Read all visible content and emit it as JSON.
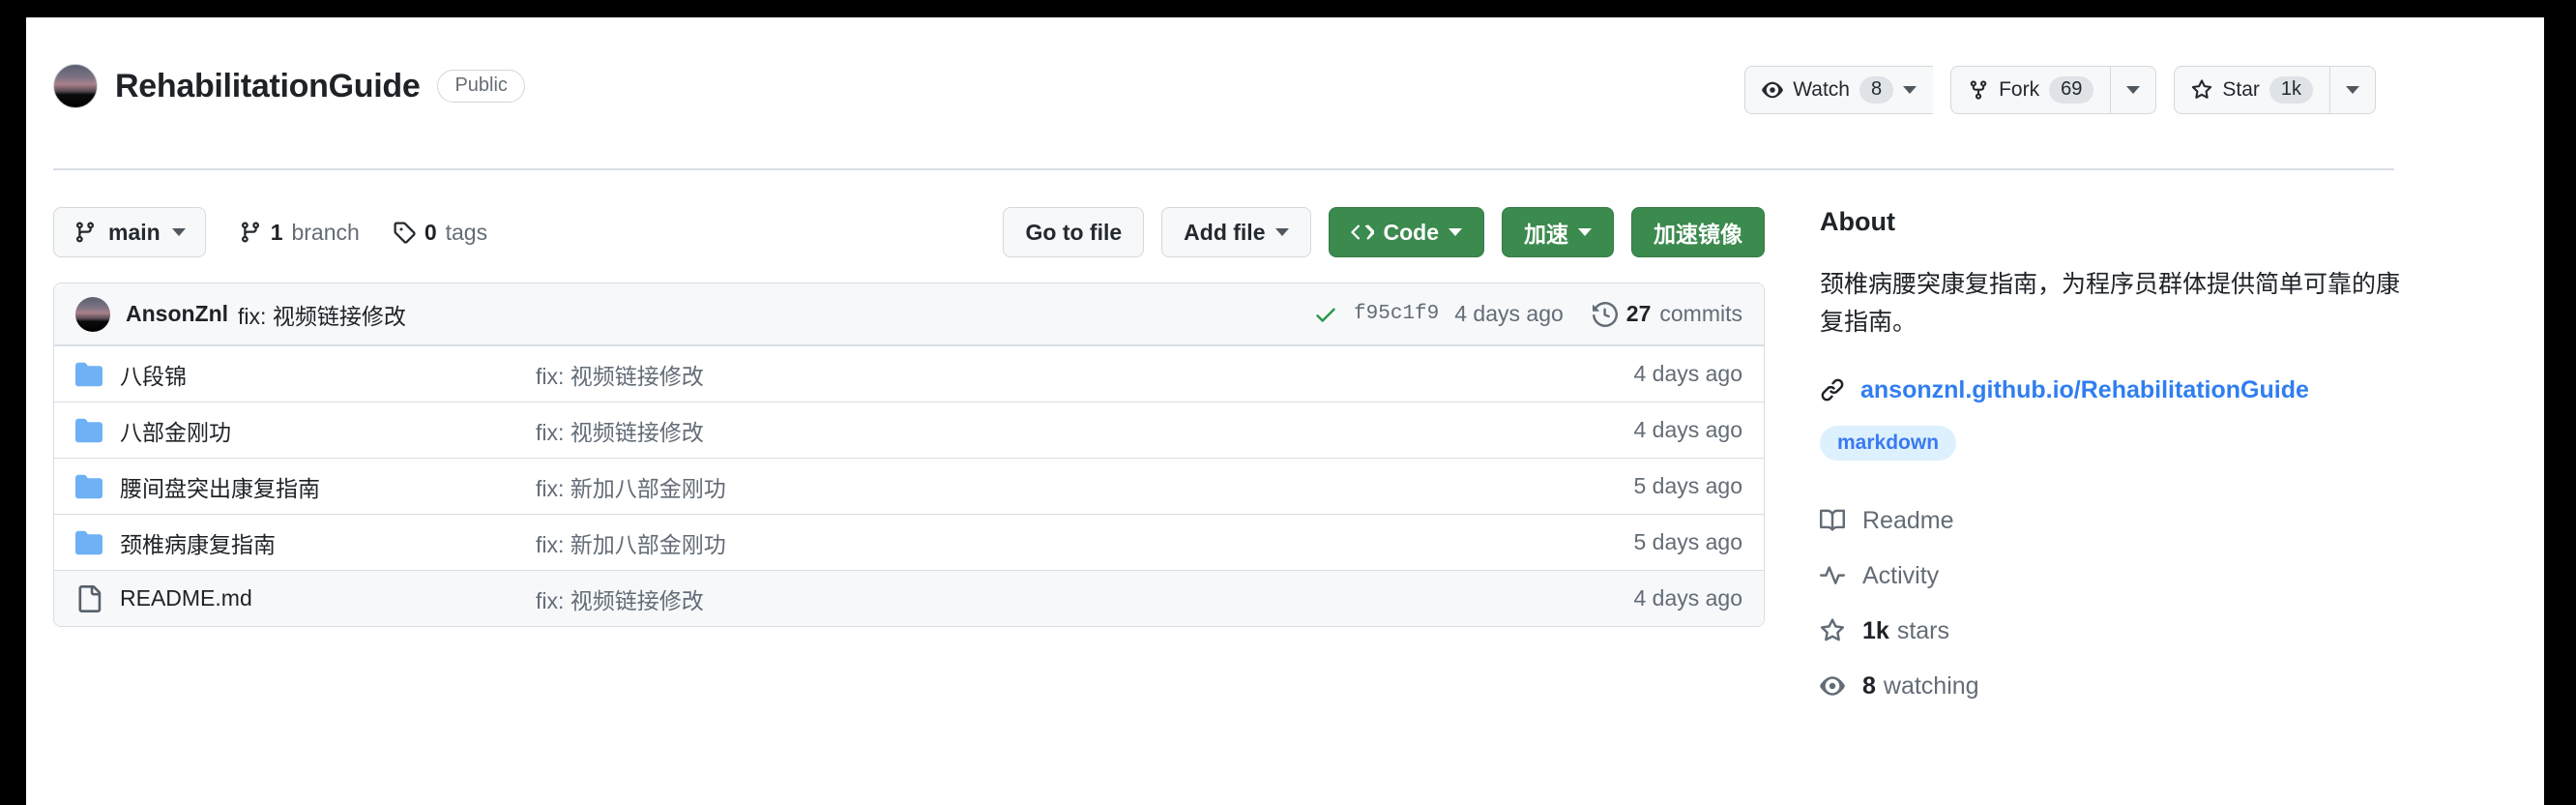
{
  "repo": {
    "owner_avatar": "owner-avatar",
    "name": "RehabilitationGuide",
    "visibility": "Public"
  },
  "header_actions": {
    "watch": {
      "label": "Watch",
      "count": "8",
      "icon": "eye-icon"
    },
    "fork": {
      "label": "Fork",
      "count": "69",
      "icon": "repo-forked-icon"
    },
    "star": {
      "label": "Star",
      "count": "1k",
      "icon": "star-icon"
    }
  },
  "toolbar": {
    "branch": "main",
    "branch_count": "1",
    "branch_label": "branch",
    "tag_count": "0",
    "tag_label": "tags",
    "go_to_file": "Go to file",
    "add_file": "Add file",
    "code": "Code",
    "accelerate": "加速",
    "accelerate_mirror": "加速镜像"
  },
  "commit_bar": {
    "author": "AnsonZnl",
    "message": "fix: 视频链接修改",
    "status_icon": "check-icon",
    "hash": "f95c1f9",
    "time": "4 days ago",
    "commits_count": "27",
    "commits_label": "commits"
  },
  "files": [
    {
      "icon": "folder-icon",
      "name": "八段锦",
      "message": "fix: 视频链接修改",
      "time": "4 days ago",
      "highlight": false
    },
    {
      "icon": "folder-icon",
      "name": "八部金刚功",
      "message": "fix: 视频链接修改",
      "time": "4 days ago",
      "highlight": false
    },
    {
      "icon": "folder-icon",
      "name": "腰间盘突出康复指南",
      "message": "fix: 新加八部金刚功",
      "time": "5 days ago",
      "highlight": false
    },
    {
      "icon": "folder-icon",
      "name": "颈椎病康复指南",
      "message": "fix: 新加八部金刚功",
      "time": "5 days ago",
      "highlight": false
    },
    {
      "icon": "file-icon",
      "name": "README.md",
      "message": "fix: 视频链接修改",
      "time": "4 days ago",
      "highlight": true
    }
  ],
  "sidebar": {
    "about_title": "About",
    "description": "颈椎病腰突康复指南，为程序员群体提供简单可靠的康复指南。",
    "homepage": "ansonznl.github.io/RehabilitationGuide",
    "topics": [
      "markdown"
    ],
    "links": [
      {
        "icon": "book-icon",
        "label": "Readme"
      },
      {
        "icon": "pulse-icon",
        "label": "Activity"
      },
      {
        "icon": "star-icon",
        "label_bold": "1k",
        "label": "stars"
      },
      {
        "icon": "eye-icon",
        "label_bold": "8",
        "label": "watching"
      }
    ]
  },
  "colors": {
    "green_button": "#3b8a4e",
    "link_blue": "#2f7ef0",
    "topic_bg": "#ddf0fd",
    "folder_blue": "#6fb1f5",
    "check_green": "#2c974b",
    "border": "#d8dee4"
  }
}
